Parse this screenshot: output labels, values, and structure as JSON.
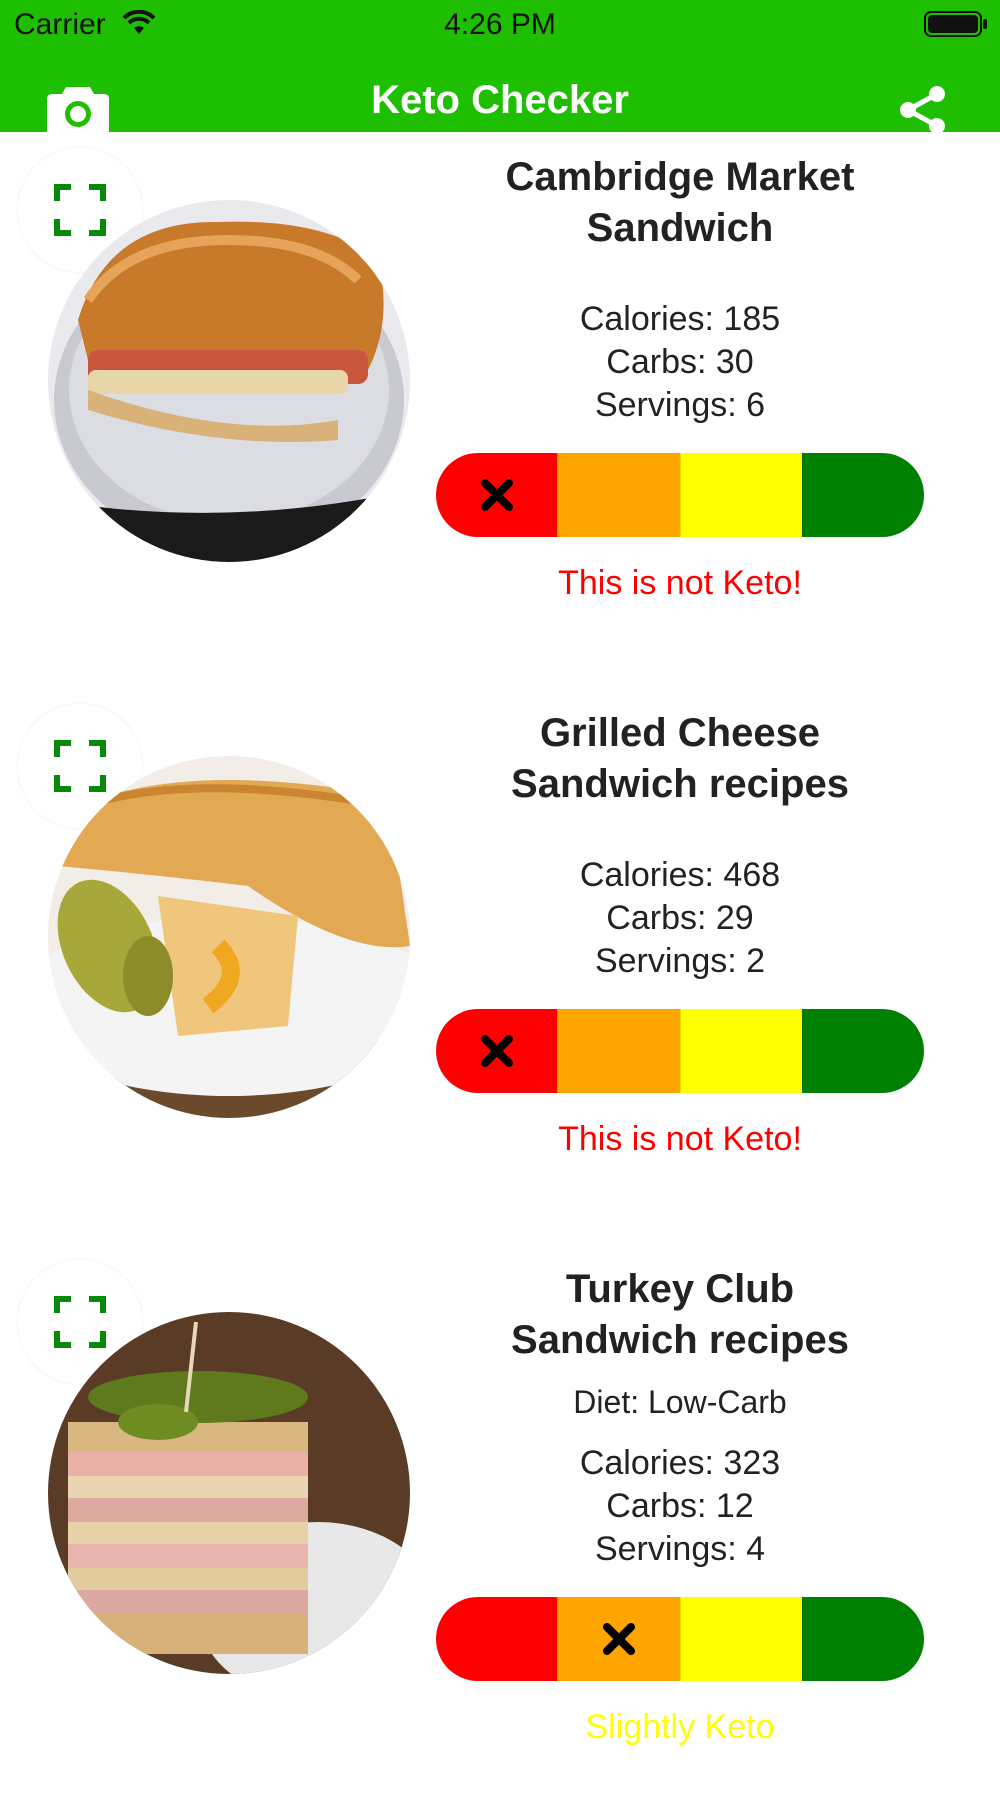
{
  "status_bar": {
    "carrier": "Carrier",
    "time": "4:26 PM"
  },
  "nav": {
    "title": "Keto Checker",
    "left_icon": "camera-icon",
    "right_icon": "share-icon"
  },
  "colors": {
    "brand": "#1ebe00",
    "meter": [
      "#ff0000",
      "#ffa500",
      "#ffff00",
      "#008000"
    ],
    "not_keto_text": "#ff0000",
    "slightly_keto_text": "#ffff00"
  },
  "foods": [
    {
      "title_line1": "Cambridge Market",
      "title_line2": "Sandwich",
      "calories": "Calories: 185",
      "carbs": "Carbs: 30",
      "servings": "Servings: 6",
      "rating_index": 0,
      "verdict": "This is not Keto!"
    },
    {
      "title_line1": "Grilled Cheese",
      "title_line2": "Sandwich recipes",
      "calories": "Calories: 468",
      "carbs": "Carbs: 29",
      "servings": "Servings: 2",
      "rating_index": 0,
      "verdict": "This is not Keto!"
    },
    {
      "title_line1": "Turkey Club",
      "title_line2": "Sandwich recipes",
      "diet": "Diet: Low-Carb",
      "calories": "Calories: 323",
      "carbs": "Carbs: 12",
      "servings": "Servings: 4",
      "rating_index": 1,
      "verdict": "Slightly Keto"
    }
  ]
}
